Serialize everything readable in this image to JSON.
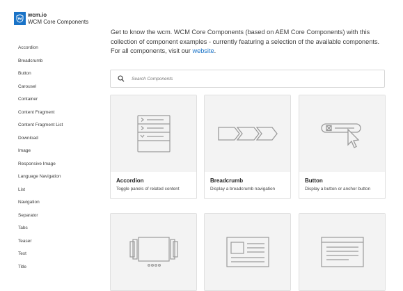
{
  "logo": {
    "brand": "wcm.io",
    "subtitle": "WCM Core Components"
  },
  "sidebar": {
    "items": [
      {
        "label": "Accordion"
      },
      {
        "label": "Breadcrumb"
      },
      {
        "label": "Button"
      },
      {
        "label": "Carousel"
      },
      {
        "label": "Container"
      },
      {
        "label": "Content Fragment"
      },
      {
        "label": "Content Fragment List"
      },
      {
        "label": "Download"
      },
      {
        "label": "Image"
      },
      {
        "label": "Responsive Image"
      },
      {
        "label": "Language Navigation"
      },
      {
        "label": "List"
      },
      {
        "label": "Navigation"
      },
      {
        "label": "Separator"
      },
      {
        "label": "Tabs"
      },
      {
        "label": "Teaser"
      },
      {
        "label": "Text"
      },
      {
        "label": "Title"
      }
    ]
  },
  "intro": {
    "text": "Get to know the wcm. WCM Core Components (based on AEM Core Components) with this collection of component examples - currently featuring a selection of the available components. For all components, visit our ",
    "link_label": "website",
    "suffix": "."
  },
  "search": {
    "placeholder": "Search Components",
    "icon": "search-icon"
  },
  "cards": [
    {
      "title": "Accordion",
      "description": "Toggle panels of related content",
      "icon": "accordion-icon"
    },
    {
      "title": "Breadcrumb",
      "description": "Display a breadcrumb navigation",
      "icon": "breadcrumb-icon"
    },
    {
      "title": "Button",
      "description": "Display a button or anchor button",
      "icon": "button-cursor-icon"
    },
    {
      "title": "",
      "description": "",
      "icon": "carousel-icon"
    },
    {
      "title": "",
      "description": "",
      "icon": "container-icon"
    },
    {
      "title": "",
      "description": "",
      "icon": "content-fragment-icon"
    }
  ],
  "colors": {
    "accent": "#1a73c7",
    "thumb_bg": "#f3f3f3",
    "icon_stroke": "#9a9a9a"
  }
}
